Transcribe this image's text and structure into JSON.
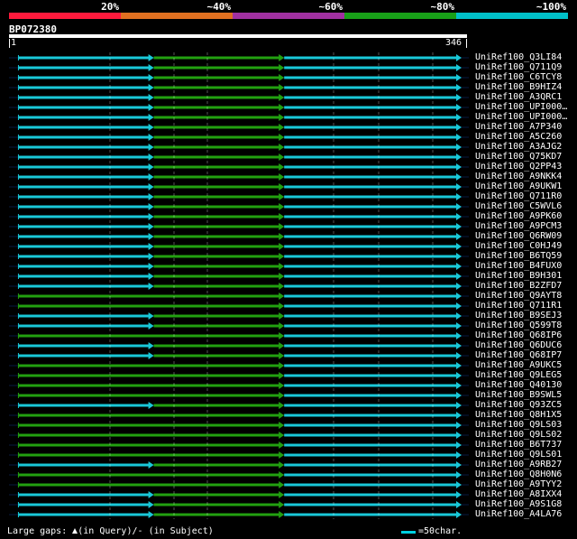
{
  "legend": {
    "labels": [
      "20%",
      "~40%",
      "~60%",
      "~80%",
      "~100%"
    ],
    "colors": [
      "#ff1a3c",
      "#e07020",
      "#a030a0",
      "#18a018",
      "#00c0c8"
    ]
  },
  "query": {
    "id": "BP072380",
    "start_label": "1",
    "end_label": "346",
    "length": 346
  },
  "hits": [
    {
      "name": "UniRef100_Q3LI84",
      "segments": [
        [
          1,
          352,
          "c"
        ],
        [
          352,
          690,
          "g"
        ],
        [
          690,
          1150,
          "c"
        ]
      ]
    },
    {
      "name": "UniRef100_Q711Q9",
      "segments": [
        [
          1,
          352,
          "c"
        ],
        [
          352,
          690,
          "g"
        ],
        [
          690,
          1150,
          "c"
        ]
      ]
    },
    {
      "name": "UniRef100_C6TCY8",
      "segments": [
        [
          1,
          352,
          "c"
        ],
        [
          352,
          690,
          "g"
        ],
        [
          690,
          1150,
          "c"
        ]
      ]
    },
    {
      "name": "UniRef100_B9HIZ4",
      "segments": [
        [
          1,
          352,
          "c"
        ],
        [
          352,
          690,
          "g"
        ],
        [
          690,
          1150,
          "c"
        ]
      ]
    },
    {
      "name": "UniRef100_A3QRC1",
      "segments": [
        [
          1,
          352,
          "c"
        ],
        [
          352,
          690,
          "g"
        ],
        [
          690,
          1150,
          "c"
        ]
      ]
    },
    {
      "name": "UniRef100_UPI000…",
      "segments": [
        [
          1,
          352,
          "c"
        ],
        [
          352,
          690,
          "g"
        ],
        [
          690,
          1150,
          "c"
        ]
      ]
    },
    {
      "name": "UniRef100_UPI000…",
      "segments": [
        [
          1,
          352,
          "c"
        ],
        [
          352,
          690,
          "g"
        ],
        [
          690,
          1150,
          "c"
        ]
      ]
    },
    {
      "name": "UniRef100_A7P340",
      "segments": [
        [
          1,
          352,
          "c"
        ],
        [
          352,
          690,
          "g"
        ],
        [
          690,
          1150,
          "c"
        ]
      ]
    },
    {
      "name": "UniRef100_A5C260",
      "segments": [
        [
          1,
          352,
          "c"
        ],
        [
          352,
          690,
          "g"
        ],
        [
          690,
          1150,
          "c"
        ]
      ]
    },
    {
      "name": "UniRef100_A3AJG2",
      "segments": [
        [
          1,
          352,
          "c"
        ],
        [
          352,
          690,
          "g"
        ],
        [
          690,
          1150,
          "c"
        ]
      ]
    },
    {
      "name": "UniRef100_Q75KD7",
      "segments": [
        [
          1,
          352,
          "c"
        ],
        [
          352,
          690,
          "g"
        ],
        [
          690,
          1150,
          "c"
        ]
      ]
    },
    {
      "name": "UniRef100_Q2PP43",
      "segments": [
        [
          1,
          352,
          "c"
        ],
        [
          352,
          690,
          "g"
        ],
        [
          690,
          1150,
          "c"
        ]
      ]
    },
    {
      "name": "UniRef100_A9NKK4",
      "segments": [
        [
          1,
          352,
          "c"
        ],
        [
          352,
          690,
          "g"
        ],
        [
          690,
          1150,
          "c"
        ]
      ]
    },
    {
      "name": "UniRef100_A9UKW1",
      "segments": [
        [
          1,
          352,
          "c"
        ],
        [
          352,
          690,
          "g"
        ],
        [
          690,
          1150,
          "c"
        ]
      ]
    },
    {
      "name": "UniRef100_Q711R0",
      "segments": [
        [
          1,
          352,
          "c"
        ],
        [
          352,
          690,
          "g"
        ],
        [
          690,
          1150,
          "c"
        ]
      ]
    },
    {
      "name": "UniRef100_C5WVL6",
      "segments": [
        [
          1,
          352,
          "c"
        ],
        [
          352,
          690,
          "g"
        ],
        [
          690,
          1150,
          "c"
        ]
      ]
    },
    {
      "name": "UniRef100_A9PK60",
      "segments": [
        [
          1,
          352,
          "c"
        ],
        [
          352,
          690,
          "g"
        ],
        [
          690,
          1150,
          "c"
        ]
      ]
    },
    {
      "name": "UniRef100_A9PCM3",
      "segments": [
        [
          1,
          352,
          "c"
        ],
        [
          352,
          690,
          "g"
        ],
        [
          690,
          1150,
          "c"
        ]
      ]
    },
    {
      "name": "UniRef100_Q6RW09",
      "segments": [
        [
          1,
          352,
          "c"
        ],
        [
          352,
          690,
          "g"
        ],
        [
          690,
          1150,
          "c"
        ]
      ]
    },
    {
      "name": "UniRef100_C0HJ49",
      "segments": [
        [
          1,
          352,
          "c"
        ],
        [
          352,
          690,
          "g"
        ],
        [
          690,
          1150,
          "c"
        ]
      ]
    },
    {
      "name": "UniRef100_B6TQ59",
      "segments": [
        [
          1,
          352,
          "c"
        ],
        [
          352,
          690,
          "g"
        ],
        [
          690,
          1150,
          "c"
        ]
      ]
    },
    {
      "name": "UniRef100_B4FUX0",
      "segments": [
        [
          1,
          352,
          "c"
        ],
        [
          352,
          690,
          "g"
        ],
        [
          690,
          1150,
          "c"
        ]
      ]
    },
    {
      "name": "UniRef100_B9H301",
      "segments": [
        [
          1,
          352,
          "c"
        ],
        [
          352,
          690,
          "g"
        ],
        [
          690,
          1150,
          "c"
        ]
      ]
    },
    {
      "name": "UniRef100_B2ZFD7",
      "segments": [
        [
          1,
          352,
          "c"
        ],
        [
          352,
          690,
          "g"
        ],
        [
          690,
          1150,
          "c"
        ]
      ]
    },
    {
      "name": "UniRef100_Q9AYT8",
      "segments": [
        [
          1,
          690,
          "g"
        ],
        [
          690,
          1150,
          "c"
        ]
      ]
    },
    {
      "name": "UniRef100_Q711R1",
      "segments": [
        [
          1,
          690,
          "g"
        ],
        [
          690,
          1150,
          "c"
        ]
      ]
    },
    {
      "name": "UniRef100_B9SEJ3",
      "segments": [
        [
          1,
          352,
          "c"
        ],
        [
          352,
          690,
          "g"
        ],
        [
          690,
          1150,
          "c"
        ]
      ]
    },
    {
      "name": "UniRef100_Q599T8",
      "segments": [
        [
          1,
          352,
          "c"
        ],
        [
          352,
          690,
          "g"
        ],
        [
          690,
          1150,
          "c"
        ]
      ]
    },
    {
      "name": "UniRef100_Q68IP6",
      "segments": [
        [
          1,
          690,
          "g"
        ],
        [
          690,
          1150,
          "c"
        ]
      ]
    },
    {
      "name": "UniRef100_Q6DUC6",
      "segments": [
        [
          1,
          352,
          "c"
        ],
        [
          352,
          690,
          "g"
        ],
        [
          690,
          1150,
          "c"
        ]
      ]
    },
    {
      "name": "UniRef100_Q68IP7",
      "segments": [
        [
          1,
          352,
          "c"
        ],
        [
          352,
          690,
          "g"
        ],
        [
          690,
          1150,
          "c"
        ]
      ]
    },
    {
      "name": "UniRef100_A9UKC5",
      "segments": [
        [
          1,
          690,
          "g"
        ],
        [
          690,
          1150,
          "c"
        ]
      ]
    },
    {
      "name": "UniRef100_Q9LEG5",
      "segments": [
        [
          1,
          690,
          "g"
        ],
        [
          690,
          1150,
          "c"
        ]
      ]
    },
    {
      "name": "UniRef100_Q40130",
      "segments": [
        [
          1,
          690,
          "g"
        ],
        [
          690,
          1150,
          "c"
        ]
      ]
    },
    {
      "name": "UniRef100_B9SWL5",
      "segments": [
        [
          1,
          690,
          "g"
        ],
        [
          690,
          1150,
          "c"
        ]
      ]
    },
    {
      "name": "UniRef100_Q93ZC5",
      "segments": [
        [
          1,
          352,
          "c"
        ],
        [
          352,
          690,
          "g"
        ],
        [
          690,
          1150,
          "c"
        ]
      ]
    },
    {
      "name": "UniRef100_Q8H1X5",
      "segments": [
        [
          1,
          690,
          "g"
        ],
        [
          690,
          1150,
          "c"
        ]
      ]
    },
    {
      "name": "UniRef100_Q9LS03",
      "segments": [
        [
          1,
          690,
          "g"
        ],
        [
          690,
          1150,
          "c"
        ]
      ]
    },
    {
      "name": "UniRef100_Q9LS02",
      "segments": [
        [
          1,
          690,
          "g"
        ],
        [
          690,
          1150,
          "c"
        ]
      ]
    },
    {
      "name": "UniRef100_B6T737",
      "segments": [
        [
          1,
          690,
          "g"
        ],
        [
          690,
          1150,
          "c"
        ]
      ]
    },
    {
      "name": "UniRef100_Q9LS01",
      "segments": [
        [
          1,
          690,
          "g"
        ],
        [
          690,
          1150,
          "c"
        ]
      ]
    },
    {
      "name": "UniRef100_A9RB27",
      "segments": [
        [
          1,
          352,
          "c"
        ],
        [
          352,
          690,
          "g"
        ],
        [
          690,
          1150,
          "c"
        ]
      ]
    },
    {
      "name": "UniRef100_Q8H0N6",
      "segments": [
        [
          1,
          690,
          "g"
        ],
        [
          690,
          1150,
          "c"
        ]
      ]
    },
    {
      "name": "UniRef100_A9TYY2",
      "segments": [
        [
          1,
          690,
          "g"
        ],
        [
          690,
          1150,
          "c"
        ]
      ]
    },
    {
      "name": "UniRef100_A8IXX4",
      "segments": [
        [
          1,
          352,
          "c"
        ],
        [
          352,
          690,
          "g"
        ],
        [
          690,
          1150,
          "c"
        ]
      ]
    },
    {
      "name": "UniRef100_A9S1G8",
      "segments": [
        [
          1,
          352,
          "c"
        ],
        [
          352,
          690,
          "g"
        ],
        [
          690,
          1150,
          "c"
        ]
      ]
    },
    {
      "name": "UniRef100_A4LA76",
      "segments": [
        [
          1,
          352,
          "c"
        ],
        [
          352,
          690,
          "g"
        ],
        [
          690,
          1150,
          "c"
        ]
      ]
    }
  ],
  "footer": {
    "large_gaps_label": "Large gaps:",
    "in_query": "(in Query)",
    "separator": "/",
    "dash": "-",
    "in_subject": "(in Subject)",
    "scale_label": "=50char."
  }
}
